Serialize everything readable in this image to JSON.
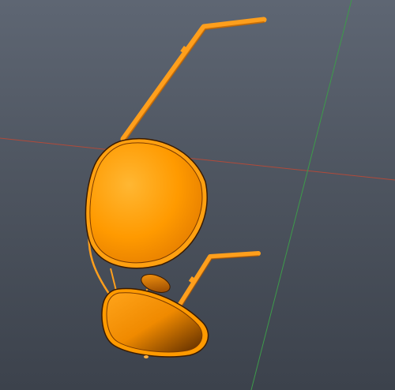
{
  "viewport": {
    "background_top": "#5e6673",
    "background_bottom": "#3c424c",
    "grid_axis_x_color": "#b04a3a",
    "grid_axis_z_color": "#3d9a4a"
  },
  "model": {
    "name_icon": "aviator-sunglasses-model",
    "frame_color": "#ff9f1c",
    "lens_color": "#ff9a00",
    "shadow_color": "#6b3200"
  }
}
